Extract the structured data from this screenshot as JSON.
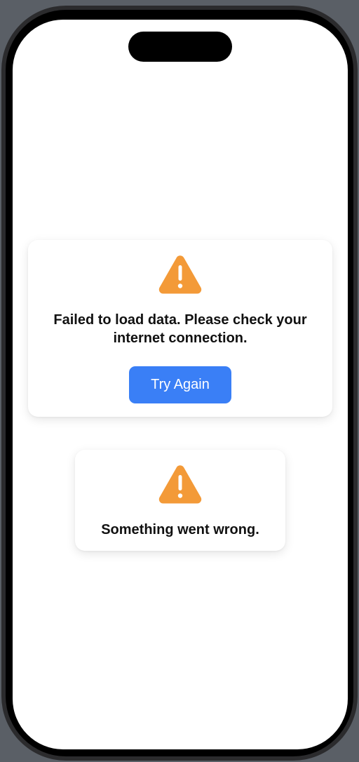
{
  "colors": {
    "warning": "#f39a38",
    "accent": "#3a7ff6",
    "text": "#111111",
    "background": "#ffffff"
  },
  "primary_error": {
    "icon": "warning-triangle-icon",
    "message": "Failed to load data. Please check your internet connection.",
    "retry_label": "Try Again"
  },
  "secondary_error": {
    "icon": "warning-triangle-icon",
    "message": "Something went wrong."
  }
}
